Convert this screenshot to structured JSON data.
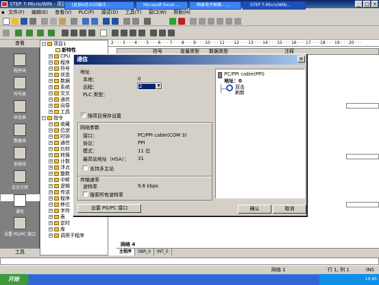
{
  "window": {
    "title": "STEP 7-Micro/WIN - 项目1 - [SIMATIC LAD]"
  },
  "menu": [
    "文件(F)",
    "编辑(E)",
    "查看(V)",
    "PLC(P)",
    "调试(D)",
    "工具(T)",
    "窗口(W)",
    "帮助(H)"
  ],
  "nav": {
    "header": "查看",
    "items": [
      "程序块",
      "符号表",
      "状态表",
      "数据块",
      "系统块",
      "交叉引用",
      "通信",
      "设置 PG/PC 接口"
    ],
    "footer": "工具"
  },
  "tree": {
    "items": [
      "项目1",
      "新特性",
      "CPU",
      "程序",
      "符号",
      "状态",
      "数据",
      "系统",
      "交叉",
      "通信",
      "向导",
      "工具",
      "指令",
      "收藏",
      "位逻",
      "时钟",
      "通信",
      "比较",
      "转换",
      "计数",
      "浮点",
      "整数",
      "中断",
      "逻辑",
      "传送",
      "程序",
      "移位",
      "字符",
      "表",
      "定时",
      "库",
      "调用子程序"
    ]
  },
  "editor": {
    "ruler": "· 2 · · · 3 · · · 4 · · · 5 · · · 6 · · · 7 · · · 8 · · · 9 · · · 10 · · · 11 · · · 12 · · · 13 · · · 14 · · · 15 · · · 16 · · · 17 · · · 18 · · · 19 · · · 20 · · ·",
    "col_symbol": "符号",
    "col_vartype": "变量类型",
    "col_datatype": "数据类型",
    "col_comment": "注释",
    "network": "网络 4",
    "tabs": [
      "主程序",
      "SBR_0",
      "INT_0"
    ]
  },
  "dialog": {
    "title": "通信",
    "address_group": "地址",
    "local_label": "本地：",
    "local_value": "0",
    "remote_label": "远程：",
    "remote_value": "2",
    "plc_type_label": "PLC 类型：",
    "save_with_project": "随项目保存设置",
    "net_group": "网络参数",
    "interface_label": "接口：",
    "interface_value": "PC/PPI cable(COM 3)",
    "protocol_label": "协议：",
    "protocol_value": "PPI",
    "mode_label": "模式：",
    "mode_value": "11 位",
    "hsa_label": "最高站地址（HSA）：",
    "hsa_value": "31",
    "multimaster": "支持多主站",
    "rate_group": "传输速率",
    "baud_label": "波特率",
    "baud_value": "9.6 kbps",
    "search_all": "搜索所有波特率",
    "setup_pgpc": "设置 PG/PC 接口",
    "ok": "确认",
    "cancel": "取消",
    "tree_cable": "PC/PPI cable(PPI)",
    "tree_address": "地址：0",
    "tree_doubleclick": "双击",
    "tree_refresh": "刷新"
  },
  "status": {
    "network": "网络 1",
    "position": "行 1, 列 1",
    "mode": "INS"
  },
  "taskbar": {
    "start": "开始",
    "tasks": [
      "[此刻6月20日脑冷…",
      "Microsoft Excel …",
      "网易电子邮箱 - …",
      "STEP 7-Micro/WIN…"
    ],
    "clock": "10:45"
  }
}
